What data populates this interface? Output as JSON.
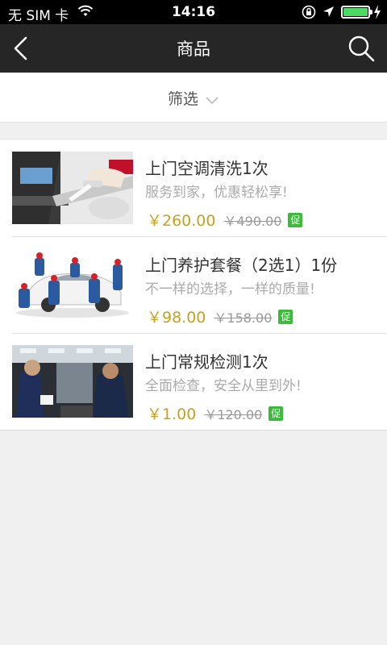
{
  "status_bar": {
    "carrier": "无 SIM 卡",
    "time": "14:16"
  },
  "nav": {
    "title": "商品"
  },
  "filter": {
    "label": "筛选"
  },
  "products": [
    {
      "name": "上门空调清洗1次",
      "description": "服务到家，优惠轻松享!",
      "price": "￥260.00",
      "original_price": "￥490.00",
      "promo_badge": "促"
    },
    {
      "name": "上门养护套餐（2选1）1份",
      "description": "不一样的选择，一样的质量!",
      "price": "￥98.00",
      "original_price": "￥158.00",
      "promo_badge": "促"
    },
    {
      "name": "上门常规检测1次",
      "description": "全面检查，安全从里到外!",
      "price": "￥1.00",
      "original_price": "￥120.00",
      "promo_badge": "促"
    }
  ],
  "colors": {
    "nav_bg": "#262626",
    "price": "#c8a020",
    "promo_badge": "#3cba3c",
    "battery": "#4cd964"
  }
}
